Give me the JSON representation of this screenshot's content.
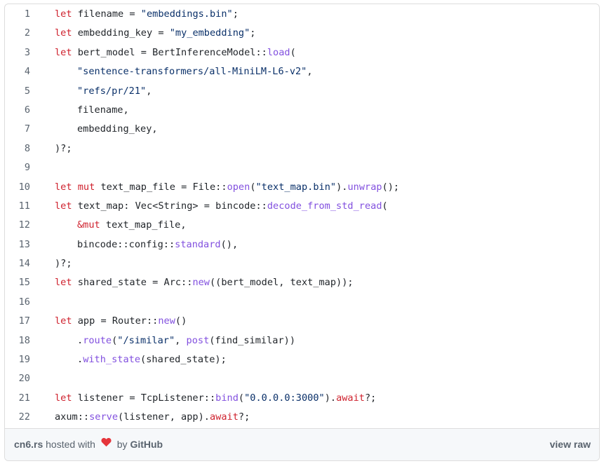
{
  "code": {
    "language": "rust",
    "lines": [
      {
        "n": "1",
        "indent": 0,
        "tokens": [
          [
            "kw",
            "let"
          ],
          [
            "p",
            " filename = "
          ],
          [
            "str",
            "\"embeddings.bin\""
          ],
          [
            "p",
            ";"
          ]
        ]
      },
      {
        "n": "2",
        "indent": 0,
        "tokens": [
          [
            "kw",
            "let"
          ],
          [
            "p",
            " embedding_key = "
          ],
          [
            "str",
            "\"my_embedding\""
          ],
          [
            "p",
            ";"
          ]
        ]
      },
      {
        "n": "3",
        "indent": 0,
        "tokens": [
          [
            "kw",
            "let"
          ],
          [
            "p",
            " bert_model = BertInferenceModel::"
          ],
          [
            "fn",
            "load"
          ],
          [
            "p",
            "("
          ]
        ]
      },
      {
        "n": "4",
        "indent": 1,
        "tokens": [
          [
            "str",
            "\"sentence-transformers/all-MiniLM-L6-v2\""
          ],
          [
            "p",
            ","
          ]
        ]
      },
      {
        "n": "5",
        "indent": 1,
        "tokens": [
          [
            "str",
            "\"refs/pr/21\""
          ],
          [
            "p",
            ","
          ]
        ]
      },
      {
        "n": "6",
        "indent": 1,
        "tokens": [
          [
            "p",
            "filename,"
          ]
        ]
      },
      {
        "n": "7",
        "indent": 1,
        "tokens": [
          [
            "p",
            "embedding_key,"
          ]
        ]
      },
      {
        "n": "8",
        "indent": 0,
        "tokens": [
          [
            "p",
            ")?;"
          ]
        ]
      },
      {
        "n": "9",
        "indent": 0,
        "tokens": []
      },
      {
        "n": "10",
        "indent": 0,
        "tokens": [
          [
            "kw",
            "let"
          ],
          [
            "p",
            " "
          ],
          [
            "kw",
            "mut"
          ],
          [
            "p",
            " text_map_file = File::"
          ],
          [
            "fn",
            "open"
          ],
          [
            "p",
            "("
          ],
          [
            "str",
            "\"text_map.bin\""
          ],
          [
            "p",
            ")."
          ],
          [
            "fn",
            "unwrap"
          ],
          [
            "p",
            "();"
          ]
        ]
      },
      {
        "n": "11",
        "indent": 0,
        "tokens": [
          [
            "kw",
            "let"
          ],
          [
            "p",
            " text_map: Vec<String> = bincode::"
          ],
          [
            "fn",
            "decode_from_std_read"
          ],
          [
            "p",
            "("
          ]
        ]
      },
      {
        "n": "12",
        "indent": 1,
        "tokens": [
          [
            "kw",
            "&mut"
          ],
          [
            "p",
            " text_map_file,"
          ]
        ]
      },
      {
        "n": "13",
        "indent": 1,
        "tokens": [
          [
            "p",
            "bincode::config::"
          ],
          [
            "fn",
            "standard"
          ],
          [
            "p",
            "(),"
          ]
        ]
      },
      {
        "n": "14",
        "indent": 0,
        "tokens": [
          [
            "p",
            ")?;"
          ]
        ]
      },
      {
        "n": "15",
        "indent": 0,
        "tokens": [
          [
            "kw",
            "let"
          ],
          [
            "p",
            " shared_state = Arc::"
          ],
          [
            "fn",
            "new"
          ],
          [
            "p",
            "((bert_model, text_map));"
          ]
        ]
      },
      {
        "n": "16",
        "indent": 0,
        "tokens": []
      },
      {
        "n": "17",
        "indent": 0,
        "tokens": [
          [
            "kw",
            "let"
          ],
          [
            "p",
            " app = Router::"
          ],
          [
            "fn",
            "new"
          ],
          [
            "p",
            "()"
          ]
        ]
      },
      {
        "n": "18",
        "indent": 1,
        "tokens": [
          [
            "p",
            "."
          ],
          [
            "fn",
            "route"
          ],
          [
            "p",
            "("
          ],
          [
            "str",
            "\"/similar\""
          ],
          [
            "p",
            ", "
          ],
          [
            "fn",
            "post"
          ],
          [
            "p",
            "(find_similar))"
          ]
        ]
      },
      {
        "n": "19",
        "indent": 1,
        "tokens": [
          [
            "p",
            "."
          ],
          [
            "fn",
            "with_state"
          ],
          [
            "p",
            "(shared_state);"
          ]
        ]
      },
      {
        "n": "20",
        "indent": 0,
        "tokens": []
      },
      {
        "n": "21",
        "indent": 0,
        "tokens": [
          [
            "kw",
            "let"
          ],
          [
            "p",
            " listener = TcpListener::"
          ],
          [
            "fn",
            "bind"
          ],
          [
            "p",
            "("
          ],
          [
            "str",
            "\"0.0.0.0:3000\""
          ],
          [
            "p",
            ")."
          ],
          [
            "kw",
            "await"
          ],
          [
            "p",
            "?;"
          ]
        ]
      },
      {
        "n": "22",
        "indent": 0,
        "tokens": [
          [
            "p",
            "axum::"
          ],
          [
            "fn",
            "serve"
          ],
          [
            "p",
            "(listener, app)."
          ],
          [
            "kw",
            "await"
          ],
          [
            "p",
            "?;"
          ]
        ]
      }
    ]
  },
  "footer": {
    "file_link": "cn6.rs",
    "hosted_text": "hosted with",
    "heart_icon": "heart-icon",
    "by_text": "by",
    "github_link": "GitHub",
    "view_raw": "view raw"
  },
  "colors": {
    "keyword": "#cf222e",
    "string": "#0a3069",
    "function": "#8250df",
    "text": "#1f2328",
    "line_number": "#59636e",
    "heart": "#e5353b"
  }
}
